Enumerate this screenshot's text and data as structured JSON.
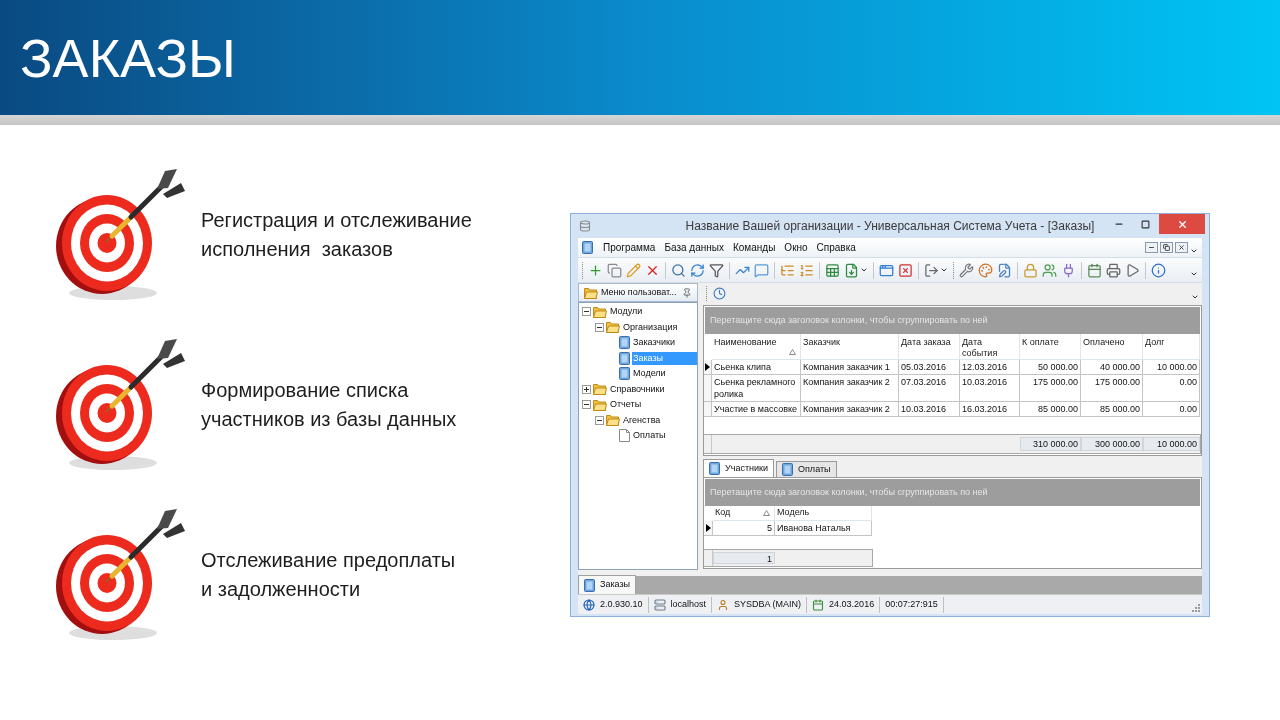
{
  "slide": {
    "title": "ЗАКАЗЫ"
  },
  "features": [
    {
      "lines": [
        "Регистрация и отслеживание",
        "исполнения  заказов"
      ]
    },
    {
      "lines": [
        "Формирование списка",
        "участников из базы данных"
      ]
    },
    {
      "lines": [
        "Отслеживание предоплаты",
        "и задолженности"
      ]
    }
  ],
  "window": {
    "title": "Название Вашей организации - Универсальная Система Учета - [Заказы]"
  },
  "menu": [
    "Программа",
    "База данных",
    "Команды",
    "Окно",
    "Справка"
  ],
  "side_panel": {
    "title": "Меню пользоват...",
    "tree": [
      {
        "label": "Модули",
        "kind": "folder",
        "expanded": true,
        "selected": false,
        "children": [
          {
            "label": "Организация",
            "kind": "folder",
            "expanded": true,
            "selected": false,
            "children": [
              {
                "label": "Заказчики",
                "kind": "form",
                "selected": false
              },
              {
                "label": "Заказы",
                "kind": "form",
                "selected": true
              },
              {
                "label": "Модели",
                "kind": "form",
                "selected": false
              }
            ]
          }
        ]
      },
      {
        "label": "Справочники",
        "kind": "folder",
        "expanded": false,
        "selected": false
      },
      {
        "label": "Отчеты",
        "kind": "folder",
        "expanded": true,
        "selected": false,
        "children": [
          {
            "label": "Агенства",
            "kind": "folder",
            "expanded": true,
            "selected": false,
            "children": [
              {
                "label": "Оплаты",
                "kind": "report",
                "selected": false
              }
            ]
          }
        ]
      }
    ]
  },
  "grid": {
    "group_hint": "Перетащите сюда заголовок колонки, чтобы сгруппировать по ней",
    "columns": [
      {
        "label": "Наименование",
        "kind": "text",
        "sorted": true
      },
      {
        "label": "Заказчик",
        "kind": "text",
        "sorted": false
      },
      {
        "label": "Дата заказа",
        "kind": "text",
        "sorted": false
      },
      {
        "label": "Дата события",
        "kind": "text",
        "sorted": false
      },
      {
        "label": "К оплате",
        "kind": "number",
        "sorted": false
      },
      {
        "label": "Оплачено",
        "kind": "number",
        "sorted": false
      },
      {
        "label": "Долг",
        "kind": "number",
        "sorted": false
      }
    ],
    "rows": [
      {
        "selected": true,
        "cells": [
          "Сьенка клипа",
          "Компания заказчик 1",
          "05.03.2016",
          "12.03.2016",
          "50 000.00",
          "40 000.00",
          "10 000.00"
        ]
      },
      {
        "selected": false,
        "cells": [
          "Сьенка рекламного ролика",
          "Компания заказчик 2",
          "07.03.2016",
          "10.03.2016",
          "175 000.00",
          "175 000.00",
          "0.00"
        ]
      },
      {
        "selected": false,
        "cells": [
          "Участие в массовке",
          "Компания заказчик 2",
          "10.03.2016",
          "16.03.2016",
          "85 000.00",
          "85 000.00",
          "0.00"
        ]
      }
    ],
    "footer": [
      {
        "kind": "blank"
      },
      {
        "kind": "blank"
      },
      {
        "kind": "blank"
      },
      {
        "kind": "blank"
      },
      {
        "kind": "total",
        "text": "310 000.00"
      },
      {
        "kind": "total",
        "text": "300 000.00"
      },
      {
        "kind": "total",
        "text": "10 000.00"
      }
    ]
  },
  "detail_tabs": [
    {
      "label": "Участники",
      "selected": true
    },
    {
      "label": "Оплаты",
      "selected": false
    }
  ],
  "detail_grid": {
    "group_hint": "Перетащите сюда заголовок колонки, чтобы сгруппировать по ней",
    "columns": [
      {
        "label": "Код",
        "kind": "number",
        "sorted": true
      },
      {
        "label": "Модель",
        "kind": "text",
        "sorted": false
      }
    ],
    "rows": [
      {
        "selected": true,
        "cells": [
          "5",
          "Иванова Наталья"
        ]
      }
    ],
    "footer": [
      {
        "kind": "total",
        "text": "1"
      },
      {
        "kind": "blank"
      }
    ]
  },
  "document_tabs": [
    {
      "label": "Заказы",
      "selected": true
    }
  ],
  "status_bar": [
    {
      "kind": "version",
      "text": "2.0.930.10"
    },
    {
      "kind": "server",
      "text": "localhost"
    },
    {
      "kind": "user",
      "text": "SYSDBA (MAIN)"
    },
    {
      "kind": "date",
      "text": "24.03.2016"
    },
    {
      "kind": "timer",
      "text": "00:07:27:915"
    }
  ]
}
